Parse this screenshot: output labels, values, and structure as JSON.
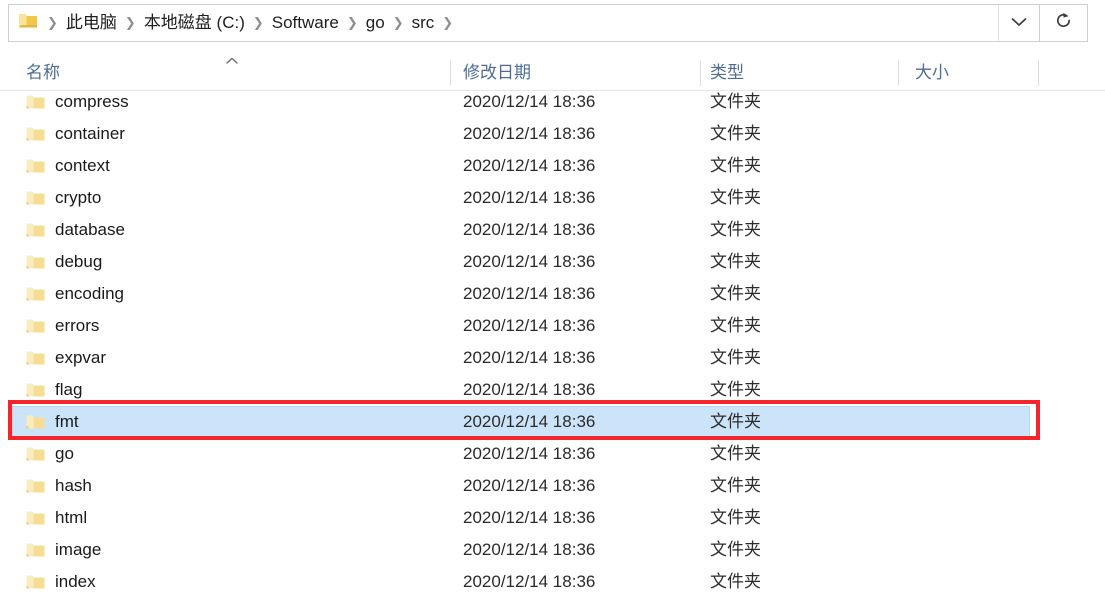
{
  "address_bar": {
    "folder_icon": "folder-icon",
    "breadcrumb_separator": "❯",
    "crumbs": [
      {
        "label": "此电脑"
      },
      {
        "label": "本地磁盘 (C:)"
      },
      {
        "label": "Software"
      },
      {
        "label": "go"
      },
      {
        "label": "src"
      }
    ],
    "dropdown_icon": "chevron-down-icon",
    "refresh_icon": "refresh-icon"
  },
  "columns": {
    "name": "名称",
    "date_modified": "修改日期",
    "type": "类型",
    "size": "大小",
    "sort_indicator": "sort-ascending-caret-icon"
  },
  "rows": [
    {
      "name": "compress",
      "date": "2020/12/14 18:36",
      "type": "文件夹",
      "size": "",
      "selected": false
    },
    {
      "name": "container",
      "date": "2020/12/14 18:36",
      "type": "文件夹",
      "size": "",
      "selected": false
    },
    {
      "name": "context",
      "date": "2020/12/14 18:36",
      "type": "文件夹",
      "size": "",
      "selected": false
    },
    {
      "name": "crypto",
      "date": "2020/12/14 18:36",
      "type": "文件夹",
      "size": "",
      "selected": false
    },
    {
      "name": "database",
      "date": "2020/12/14 18:36",
      "type": "文件夹",
      "size": "",
      "selected": false
    },
    {
      "name": "debug",
      "date": "2020/12/14 18:36",
      "type": "文件夹",
      "size": "",
      "selected": false
    },
    {
      "name": "encoding",
      "date": "2020/12/14 18:36",
      "type": "文件夹",
      "size": "",
      "selected": false
    },
    {
      "name": "errors",
      "date": "2020/12/14 18:36",
      "type": "文件夹",
      "size": "",
      "selected": false
    },
    {
      "name": "expvar",
      "date": "2020/12/14 18:36",
      "type": "文件夹",
      "size": "",
      "selected": false
    },
    {
      "name": "flag",
      "date": "2020/12/14 18:36",
      "type": "文件夹",
      "size": "",
      "selected": false
    },
    {
      "name": "fmt",
      "date": "2020/12/14 18:36",
      "type": "文件夹",
      "size": "",
      "selected": true
    },
    {
      "name": "go",
      "date": "2020/12/14 18:36",
      "type": "文件夹",
      "size": "",
      "selected": false
    },
    {
      "name": "hash",
      "date": "2020/12/14 18:36",
      "type": "文件夹",
      "size": "",
      "selected": false
    },
    {
      "name": "html",
      "date": "2020/12/14 18:36",
      "type": "文件夹",
      "size": "",
      "selected": false
    },
    {
      "name": "image",
      "date": "2020/12/14 18:36",
      "type": "文件夹",
      "size": "",
      "selected": false
    },
    {
      "name": "index",
      "date": "2020/12/14 18:36",
      "type": "文件夹",
      "size": "",
      "selected": false
    }
  ],
  "annotation": {
    "target_row": "fmt",
    "color": "#f5262b"
  },
  "colors": {
    "selection_fill": "#cce4f9",
    "selection_border": "#b3d7f2",
    "header_text": "#4f6d94",
    "folder_yellow": "#f3d785"
  }
}
